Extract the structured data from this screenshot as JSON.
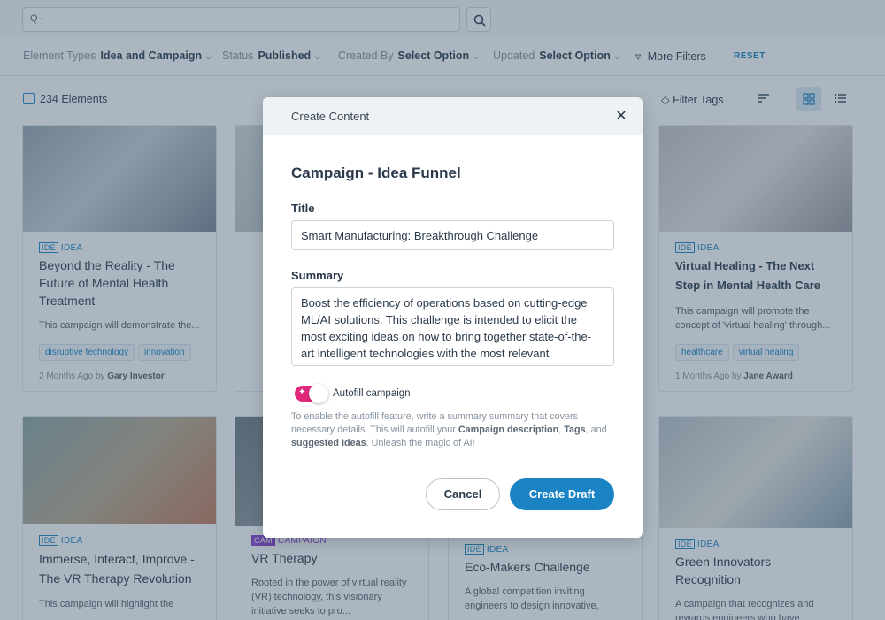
{
  "search": {
    "placeholder": "Q -"
  },
  "filters": {
    "element_types": {
      "label": "Element Types",
      "value": "Idea and Campaign"
    },
    "status": {
      "label": "Status",
      "value": "Published"
    },
    "created_by": {
      "label": "Created By",
      "value": "Select Option"
    },
    "updated": {
      "label": "Updated",
      "value": "Select Option"
    },
    "more_filters": "More Filters",
    "reset": "RESET"
  },
  "toolbar": {
    "count": "234 Elements",
    "filter_tags": "Filter Tags"
  },
  "cards": [
    {
      "type": "IDEA",
      "badge": "IDE",
      "title": "Beyond the Reality - The Future of Mental Health Treatment",
      "desc": "This campaign will demonstrate the...",
      "tags": [
        "disruptive technology",
        "innovation"
      ],
      "time": "2 Months Ago",
      "by": "by",
      "author": "Gary Investor"
    },
    {
      "type": "IDEA",
      "badge": "IDE",
      "title": "Virtual Healing - The Next Step in Mental Health Care",
      "desc": "This campaign will promote the concept of 'virtual healing' through...",
      "tags": [
        "healthcare",
        "virtual healing"
      ],
      "time": "1 Months Ago",
      "by": "by",
      "author": "Jane Award"
    },
    {
      "type": "IDEA",
      "badge": "IDE",
      "title": "Immerse, Interact, Improve - The VR Therapy Revolution",
      "desc": "This campaign will highlight the"
    },
    {
      "type": "CAMPAIGN",
      "badge": "CAM",
      "title": "VR Therapy",
      "desc": "Rooted in the power of virtual reality (VR) technology, this visionary initiative seeks to pro..."
    },
    {
      "type": "IDEA",
      "badge": "IDE",
      "title": "Eco-Makers Challenge",
      "desc": "A global competition inviting engineers to design innovative,"
    },
    {
      "type": "IDEA",
      "badge": "IDE",
      "title": "Green Innovators Recognition",
      "desc": "A campaign that recognizes and rewards engineers who have"
    }
  ],
  "modal": {
    "header": "Create Content",
    "heading": "Campaign - Idea Funnel",
    "title_label": "Title",
    "title_value": "Smart Manufacturing: Breakthrough Challenge",
    "summary_label": "Summary",
    "summary_value": "Boost the efficiency of operations based on cutting-edge ML/AI solutions. This challenge is intended to elicit the most exciting ideas on how to bring together state-of-the-art intelligent technologies with the most relevant",
    "autofill_label": "Autofill campaign",
    "autofill_on": true,
    "hint_1": "To enable the autofill feature, write a summary summary that covers necessary details. This will autofill your ",
    "hint_b1": "Campaign description",
    "hint_2": ", ",
    "hint_b2": "Tags",
    "hint_3": ", and ",
    "hint_b3": "suggested Ideas",
    "hint_4": ". Unleash the magic of AI!",
    "cancel": "Cancel",
    "create": "Create Draft"
  },
  "colors": {
    "accent": "#1a83c4",
    "toggle": "#e0287b",
    "campaign": "#8a3fd1"
  }
}
